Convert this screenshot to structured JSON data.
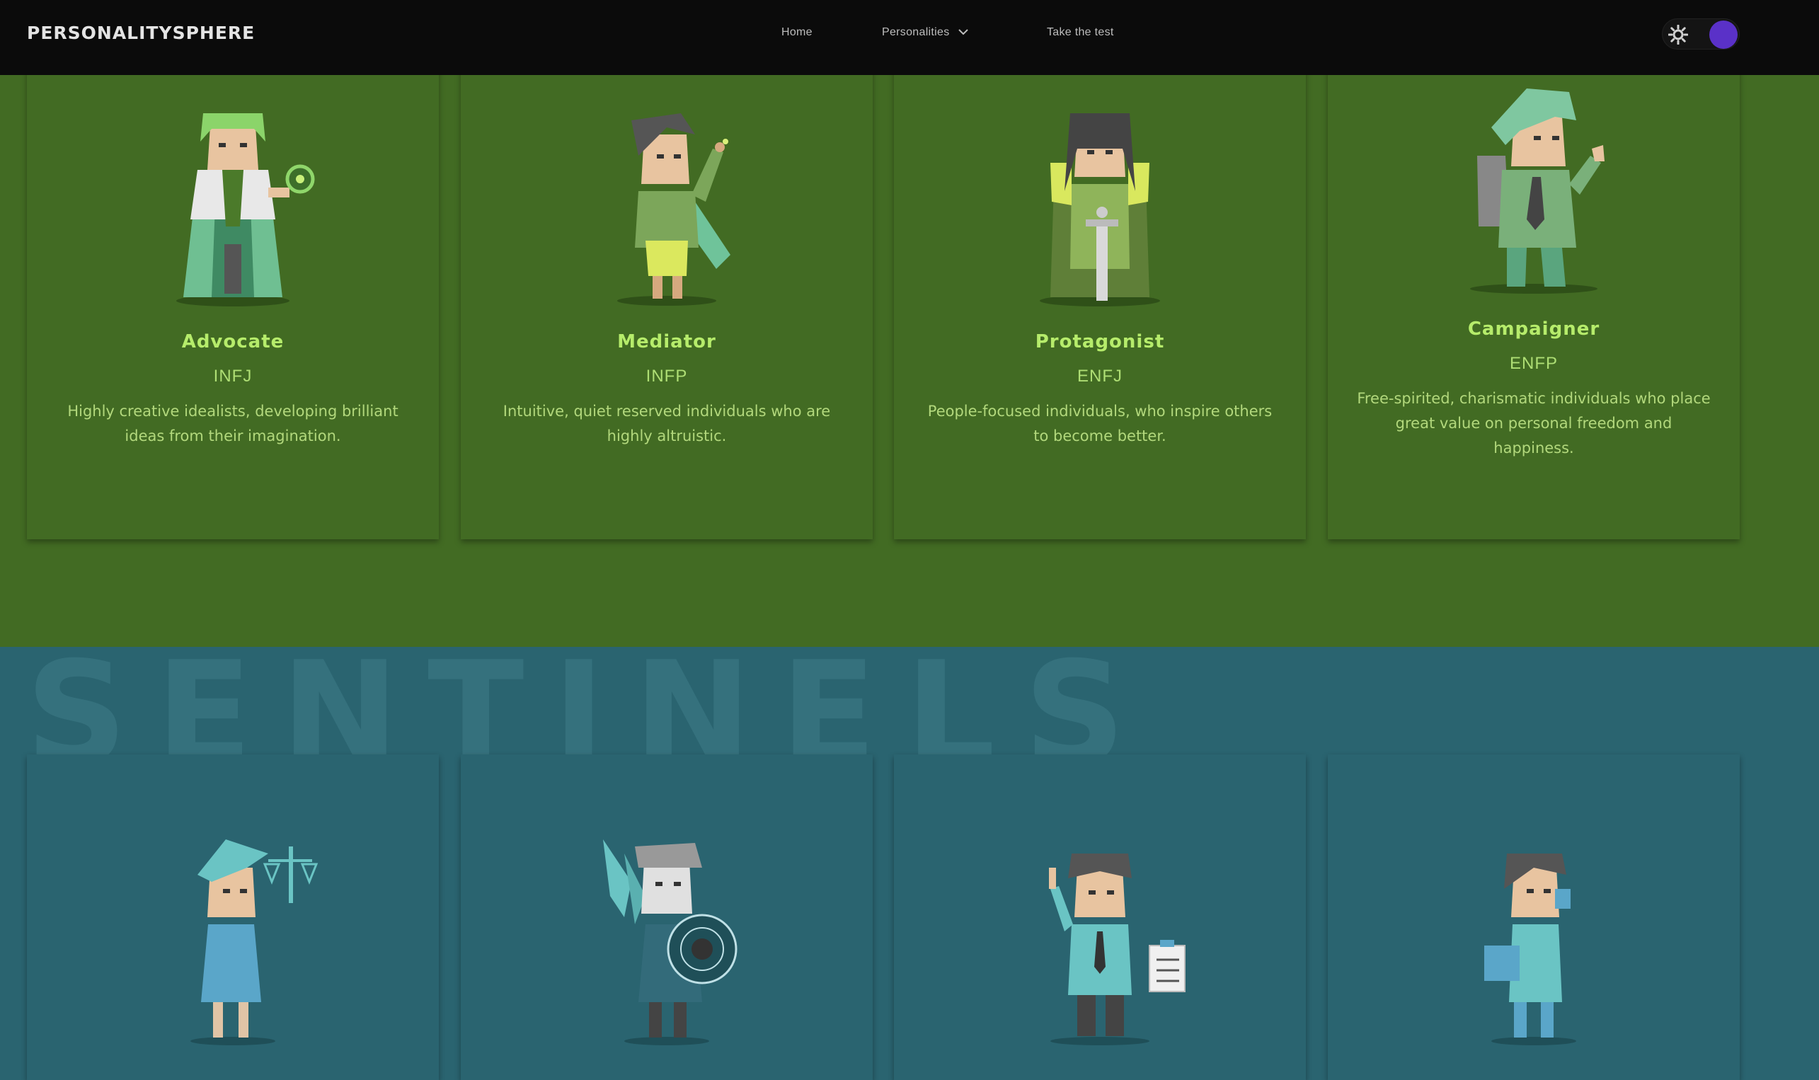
{
  "navbar": {
    "logo": "PERSONALITYSPHERE",
    "links": {
      "home": "Home",
      "personalities": "Personalities",
      "test": "Take the test"
    },
    "theme_toggle_icon": "sun-icon",
    "toggle_color": "#5a31c8"
  },
  "diplomats": {
    "color": "#426b23",
    "cards": [
      {
        "name": "Advocate",
        "code": "INFJ",
        "desc": "Highly creative idealists, developing brilliant ideas from their imagination."
      },
      {
        "name": "Mediator",
        "code": "INFP",
        "desc": "Intuitive, quiet reserved individuals who are highly altruistic."
      },
      {
        "name": "Protagonist",
        "code": "ENFJ",
        "desc": "People-focused individuals, who inspire others to become better."
      },
      {
        "name": "Campaigner",
        "code": "ENFP",
        "desc": "Free-spirited, charismatic individuals who place great value on personal freedom and happiness."
      }
    ]
  },
  "sentinels": {
    "title": "SENTINELS",
    "color": "#2a6470"
  }
}
